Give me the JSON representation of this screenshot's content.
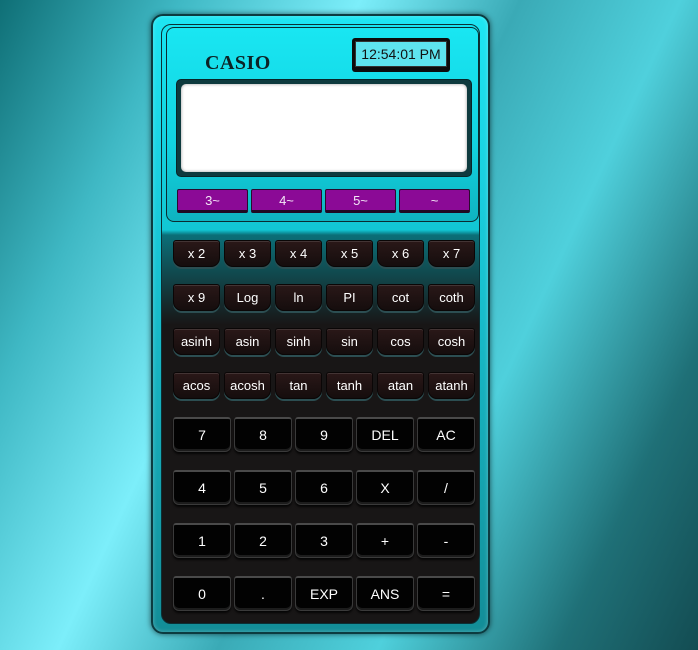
{
  "brand": "CASIO",
  "clock": "12:54:01 PM",
  "display": "",
  "mode_buttons": [
    "3~",
    "4~",
    "5~",
    "~"
  ],
  "function_rows": [
    [
      "x 2",
      "x 3",
      "x 4",
      "x 5",
      "x 6",
      "x 7"
    ],
    [
      "x 9",
      "Log",
      "ln",
      "PI",
      "cot",
      "coth"
    ],
    [
      "asinh",
      "asin",
      "sinh",
      "sin",
      "cos",
      "cosh"
    ],
    [
      "acos",
      "acosh",
      "tan",
      "tanh",
      "atan",
      "atanh"
    ]
  ],
  "keypad_rows": [
    [
      "7",
      "8",
      "9",
      "DEL",
      "AC"
    ],
    [
      "4",
      "5",
      "6",
      "X",
      "/"
    ],
    [
      "1",
      "2",
      "3",
      "+",
      "-"
    ],
    [
      "0",
      ".",
      "EXP",
      "ANS",
      "="
    ]
  ],
  "colors": {
    "body_cyan": "#1ee6f3",
    "mode_purple": "#8b0a96",
    "key_dark": "#150d0d",
    "display_bg": "#ffffff"
  }
}
